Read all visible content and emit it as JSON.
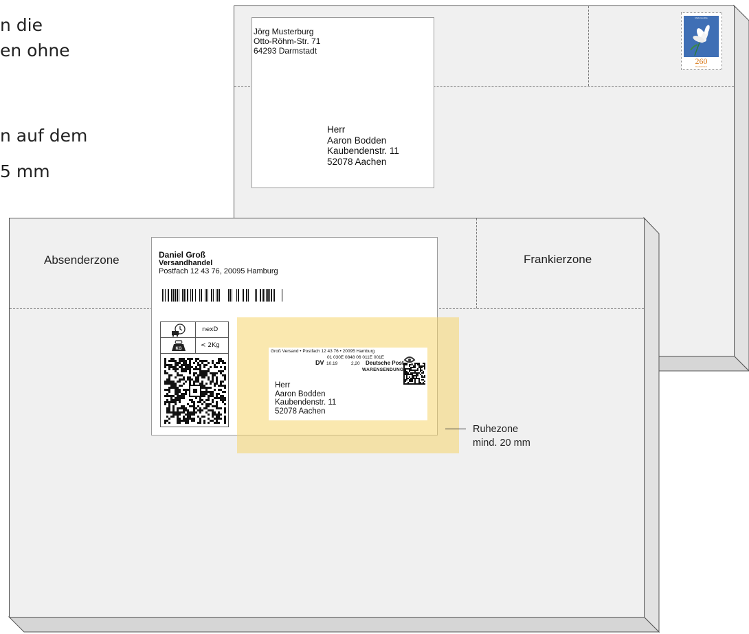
{
  "page_text": {
    "line1": "n die",
    "line2": "en ohne",
    "line3": "n auf dem",
    "line4": "5 mm"
  },
  "back_envelope": {
    "sender": [
      "Jörg Musterburg",
      "Otto-Röhm-Str. 71",
      "64293 Darmstadt"
    ],
    "recipient": [
      "Herr",
      "Aaron Bodden",
      "Kaubendenstr. 11",
      "52078 Aachen"
    ],
    "stamp_value": "260",
    "stamp_country": "Deutschland",
    "stamp_title": "Madonnenlilie"
  },
  "front_envelope": {
    "zones": {
      "sender_zone": "Absenderzone",
      "franking_zone": "Frankierzone",
      "quiet_zone_line1": "Ruhezone",
      "quiet_zone_line2": "mind. 20 mm"
    },
    "sender_label": {
      "name": "Daniel Groß",
      "company": "Versandhandel",
      "address": "Postfach 12 43 76, 20095 Hamburg"
    },
    "service_box": {
      "service": "nexD",
      "weight_icon_text": "KG",
      "weight": "< 2Kg"
    },
    "franking_label": {
      "return_line": "Groß Versand • Postfach 12 43 76 • 20095 Hamburg",
      "code_line": "01 030E 0848 06 011E 001E",
      "dv": "DV",
      "dv_date": "10.19",
      "dv_price": "2,20",
      "carrier": "Deutsche Post",
      "product": "WARENSENDUNG",
      "recipient": [
        "Herr",
        "Aaron Bodden",
        "Kaubendenstr. 11",
        "52078 Aachen"
      ]
    }
  },
  "colors": {
    "envelope": "#f0f0f0",
    "quiet_zone": "#f5dd87",
    "post_logo": "#333333"
  }
}
